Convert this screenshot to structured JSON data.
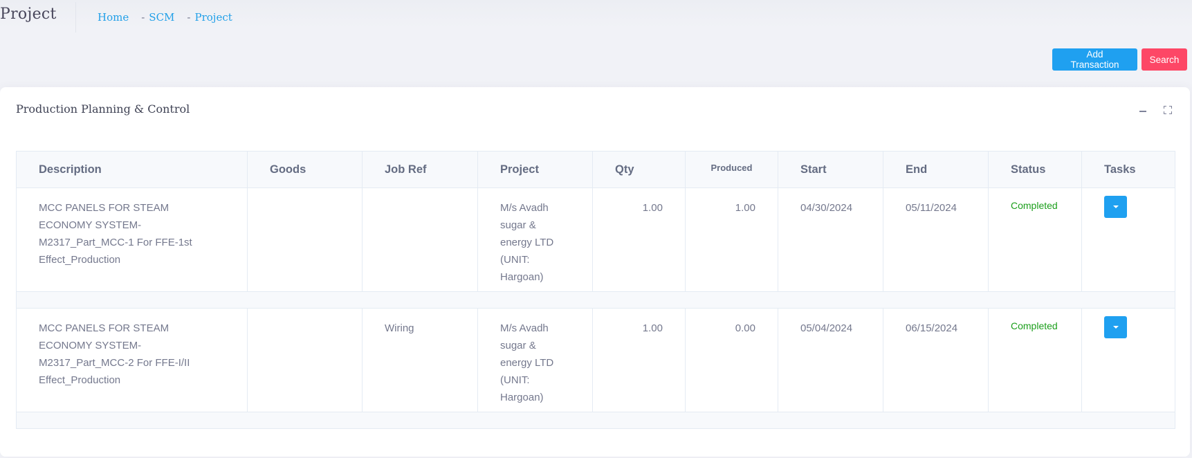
{
  "header": {
    "title": "Project",
    "breadcrumb": [
      {
        "label": "Home"
      },
      {
        "label": "SCM"
      },
      {
        "label": "Project"
      }
    ],
    "separator": "-"
  },
  "toolbar": {
    "add_transaction_label": "Add Transaction",
    "search_label": "Search"
  },
  "colors": {
    "primary": "#1fa0f0",
    "danger": "#fd4766",
    "link": "#22a0e8",
    "status_completed": "#1b9e1b"
  },
  "card": {
    "title": "Production Planning & Control",
    "tools": [
      {
        "icon": "minus-icon",
        "action": "collapse"
      },
      {
        "icon": "expand-icon",
        "action": "fullscreen"
      }
    ]
  },
  "table": {
    "columns": [
      "Description",
      "Goods",
      "Job Ref",
      "Project",
      "Qty",
      "Produced",
      "Start",
      "End",
      "Status",
      "Tasks"
    ],
    "rows": [
      {
        "description": "MCC PANELS FOR STEAM ECONOMY SYSTEM- M2317_Part_MCC-1 For FFE-1st Effect_Production",
        "goods": "",
        "job_ref": "",
        "project": "M/s Avadh sugar & energy LTD (UNIT: Hargoan)",
        "qty": "1.00",
        "produced": "1.00",
        "start": "04/30/2024",
        "end": "05/11/2024",
        "status": "Completed",
        "tasks_icon": "caret-down-icon"
      },
      {
        "description": "MCC PANELS FOR STEAM ECONOMY SYSTEM- M2317_Part_MCC-2 For FFE-I/II Effect_Production",
        "goods": "",
        "job_ref": "Wiring",
        "project": "M/s Avadh sugar & energy LTD (UNIT: Hargoan)",
        "qty": "1.00",
        "produced": "0.00",
        "start": "05/04/2024",
        "end": "06/15/2024",
        "status": "Completed",
        "tasks_icon": "caret-down-icon"
      }
    ]
  }
}
